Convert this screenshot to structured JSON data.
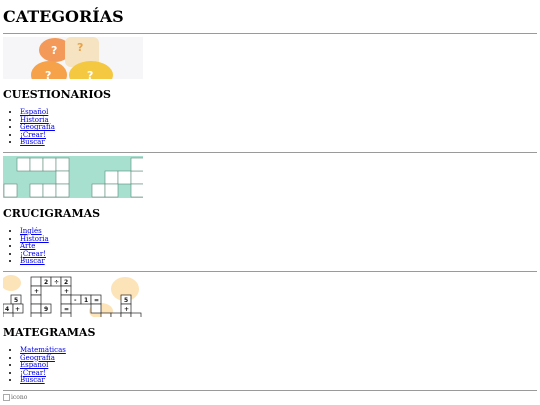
{
  "page_title": "CATEGORÍAS",
  "sections": [
    {
      "title": "CUESTIONARIOS",
      "links": [
        "Español",
        "Historia",
        "Geografía",
        "¡Crear!",
        "Buscar"
      ]
    },
    {
      "title": "CRUCIGRAMAS",
      "links": [
        "Inglés",
        "Historia",
        "Arte",
        "¡Crear!",
        "Buscar"
      ]
    },
    {
      "title": "MATEGRAMAS",
      "links": [
        "Matemáticas",
        "Geografía",
        "Español",
        "¡Crear!",
        "Buscar"
      ]
    }
  ],
  "footer": {
    "logo_alt": "icono"
  },
  "colors": {
    "link": "#0000ee",
    "crossword_bg": "#a8e0cf",
    "quiz_orange": "#f39a5a",
    "quiz_yellow": "#f5c842"
  }
}
